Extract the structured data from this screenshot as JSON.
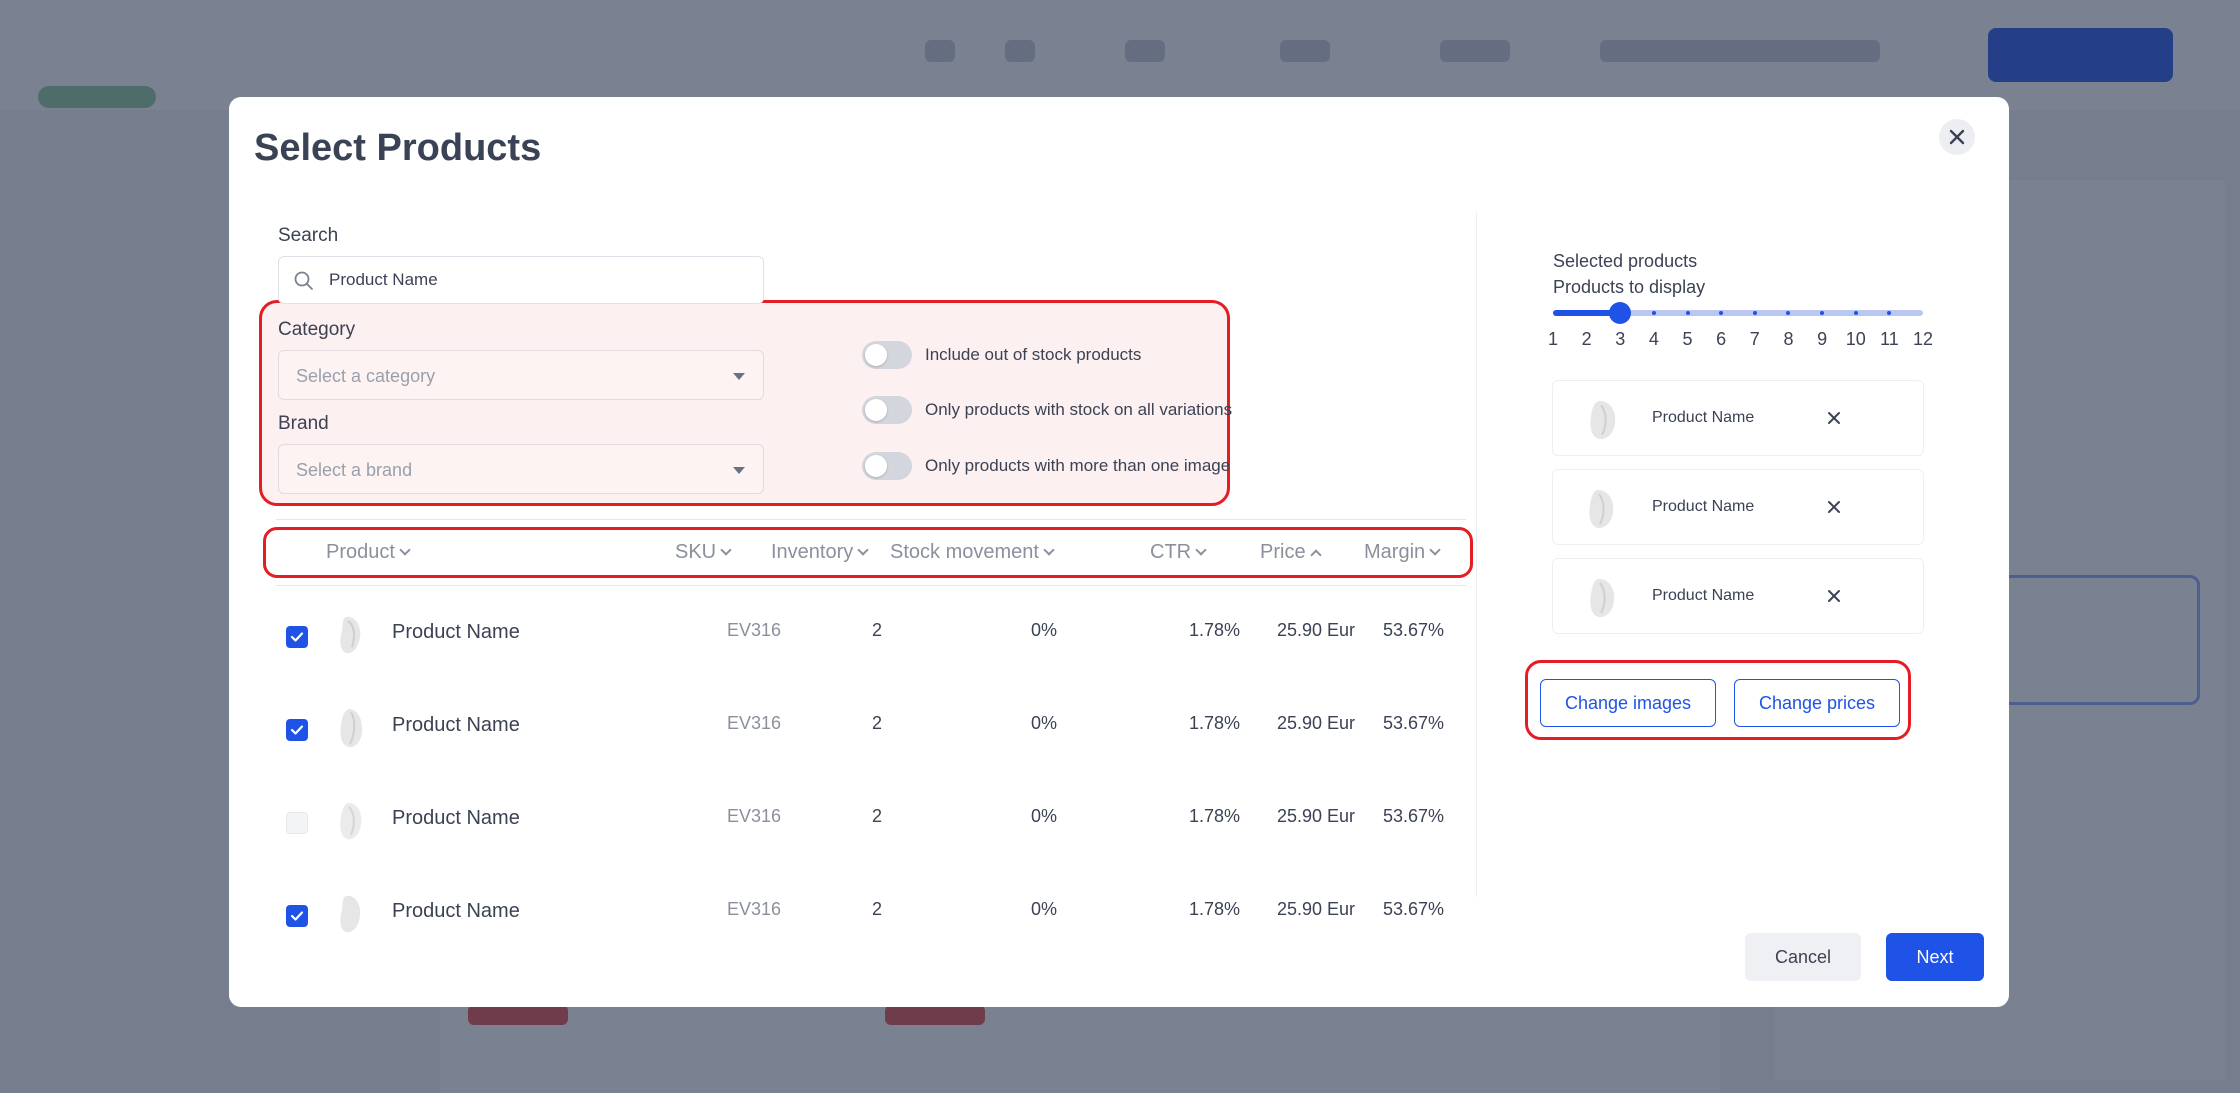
{
  "modal": {
    "title": "Select Products",
    "close_icon": "close-icon"
  },
  "search": {
    "label": "Search",
    "value": "Product Name"
  },
  "filters": {
    "category_label": "Category",
    "category_placeholder": "Select a category",
    "brand_label": "Brand",
    "brand_placeholder": "Select a brand",
    "toggles": [
      {
        "label": "Include out of stock products",
        "on": false
      },
      {
        "label": "Only products with stock on all variations",
        "on": false
      },
      {
        "label": "Only products with more than one image",
        "on": false
      }
    ]
  },
  "table": {
    "headers": {
      "product": "Product",
      "sku": "SKU",
      "inventory": "Inventory",
      "stock_movement": "Stock movement",
      "ctr": "CTR",
      "price": "Price",
      "margin": "Margin"
    },
    "sort": {
      "price": "ascending"
    },
    "rows": [
      {
        "checked": true,
        "name": "Product Name",
        "sku": "EV316",
        "inventory": "2",
        "stock_movement": "0%",
        "ctr": "1.78%",
        "price": "25.90 Eur",
        "margin": "53.67%"
      },
      {
        "checked": true,
        "name": "Product Name",
        "sku": "EV316",
        "inventory": "2",
        "stock_movement": "0%",
        "ctr": "1.78%",
        "price": "25.90 Eur",
        "margin": "53.67%"
      },
      {
        "checked": false,
        "name": "Product Name",
        "sku": "EV316",
        "inventory": "2",
        "stock_movement": "0%",
        "ctr": "1.78%",
        "price": "25.90 Eur",
        "margin": "53.67%"
      },
      {
        "checked": true,
        "name": "Product Name",
        "sku": "EV316",
        "inventory": "2",
        "stock_movement": "0%",
        "ctr": "1.78%",
        "price": "25.90 Eur",
        "margin": "53.67%"
      }
    ]
  },
  "selected": {
    "heading": "Selected products",
    "display_label": "Products to display",
    "slider_ticks": [
      "1",
      "2",
      "3",
      "4",
      "5",
      "6",
      "7",
      "8",
      "9",
      "10",
      "11",
      "12"
    ],
    "slider_value": 3,
    "items": [
      {
        "name": "Product Name"
      },
      {
        "name": "Product Name"
      },
      {
        "name": "Product Name"
      }
    ],
    "change_images_label": "Change images",
    "change_prices_label": "Change prices"
  },
  "footer": {
    "cancel_label": "Cancel",
    "next_label": "Next"
  },
  "colors": {
    "accent": "#1f53e8",
    "highlight": "#e51c23"
  }
}
